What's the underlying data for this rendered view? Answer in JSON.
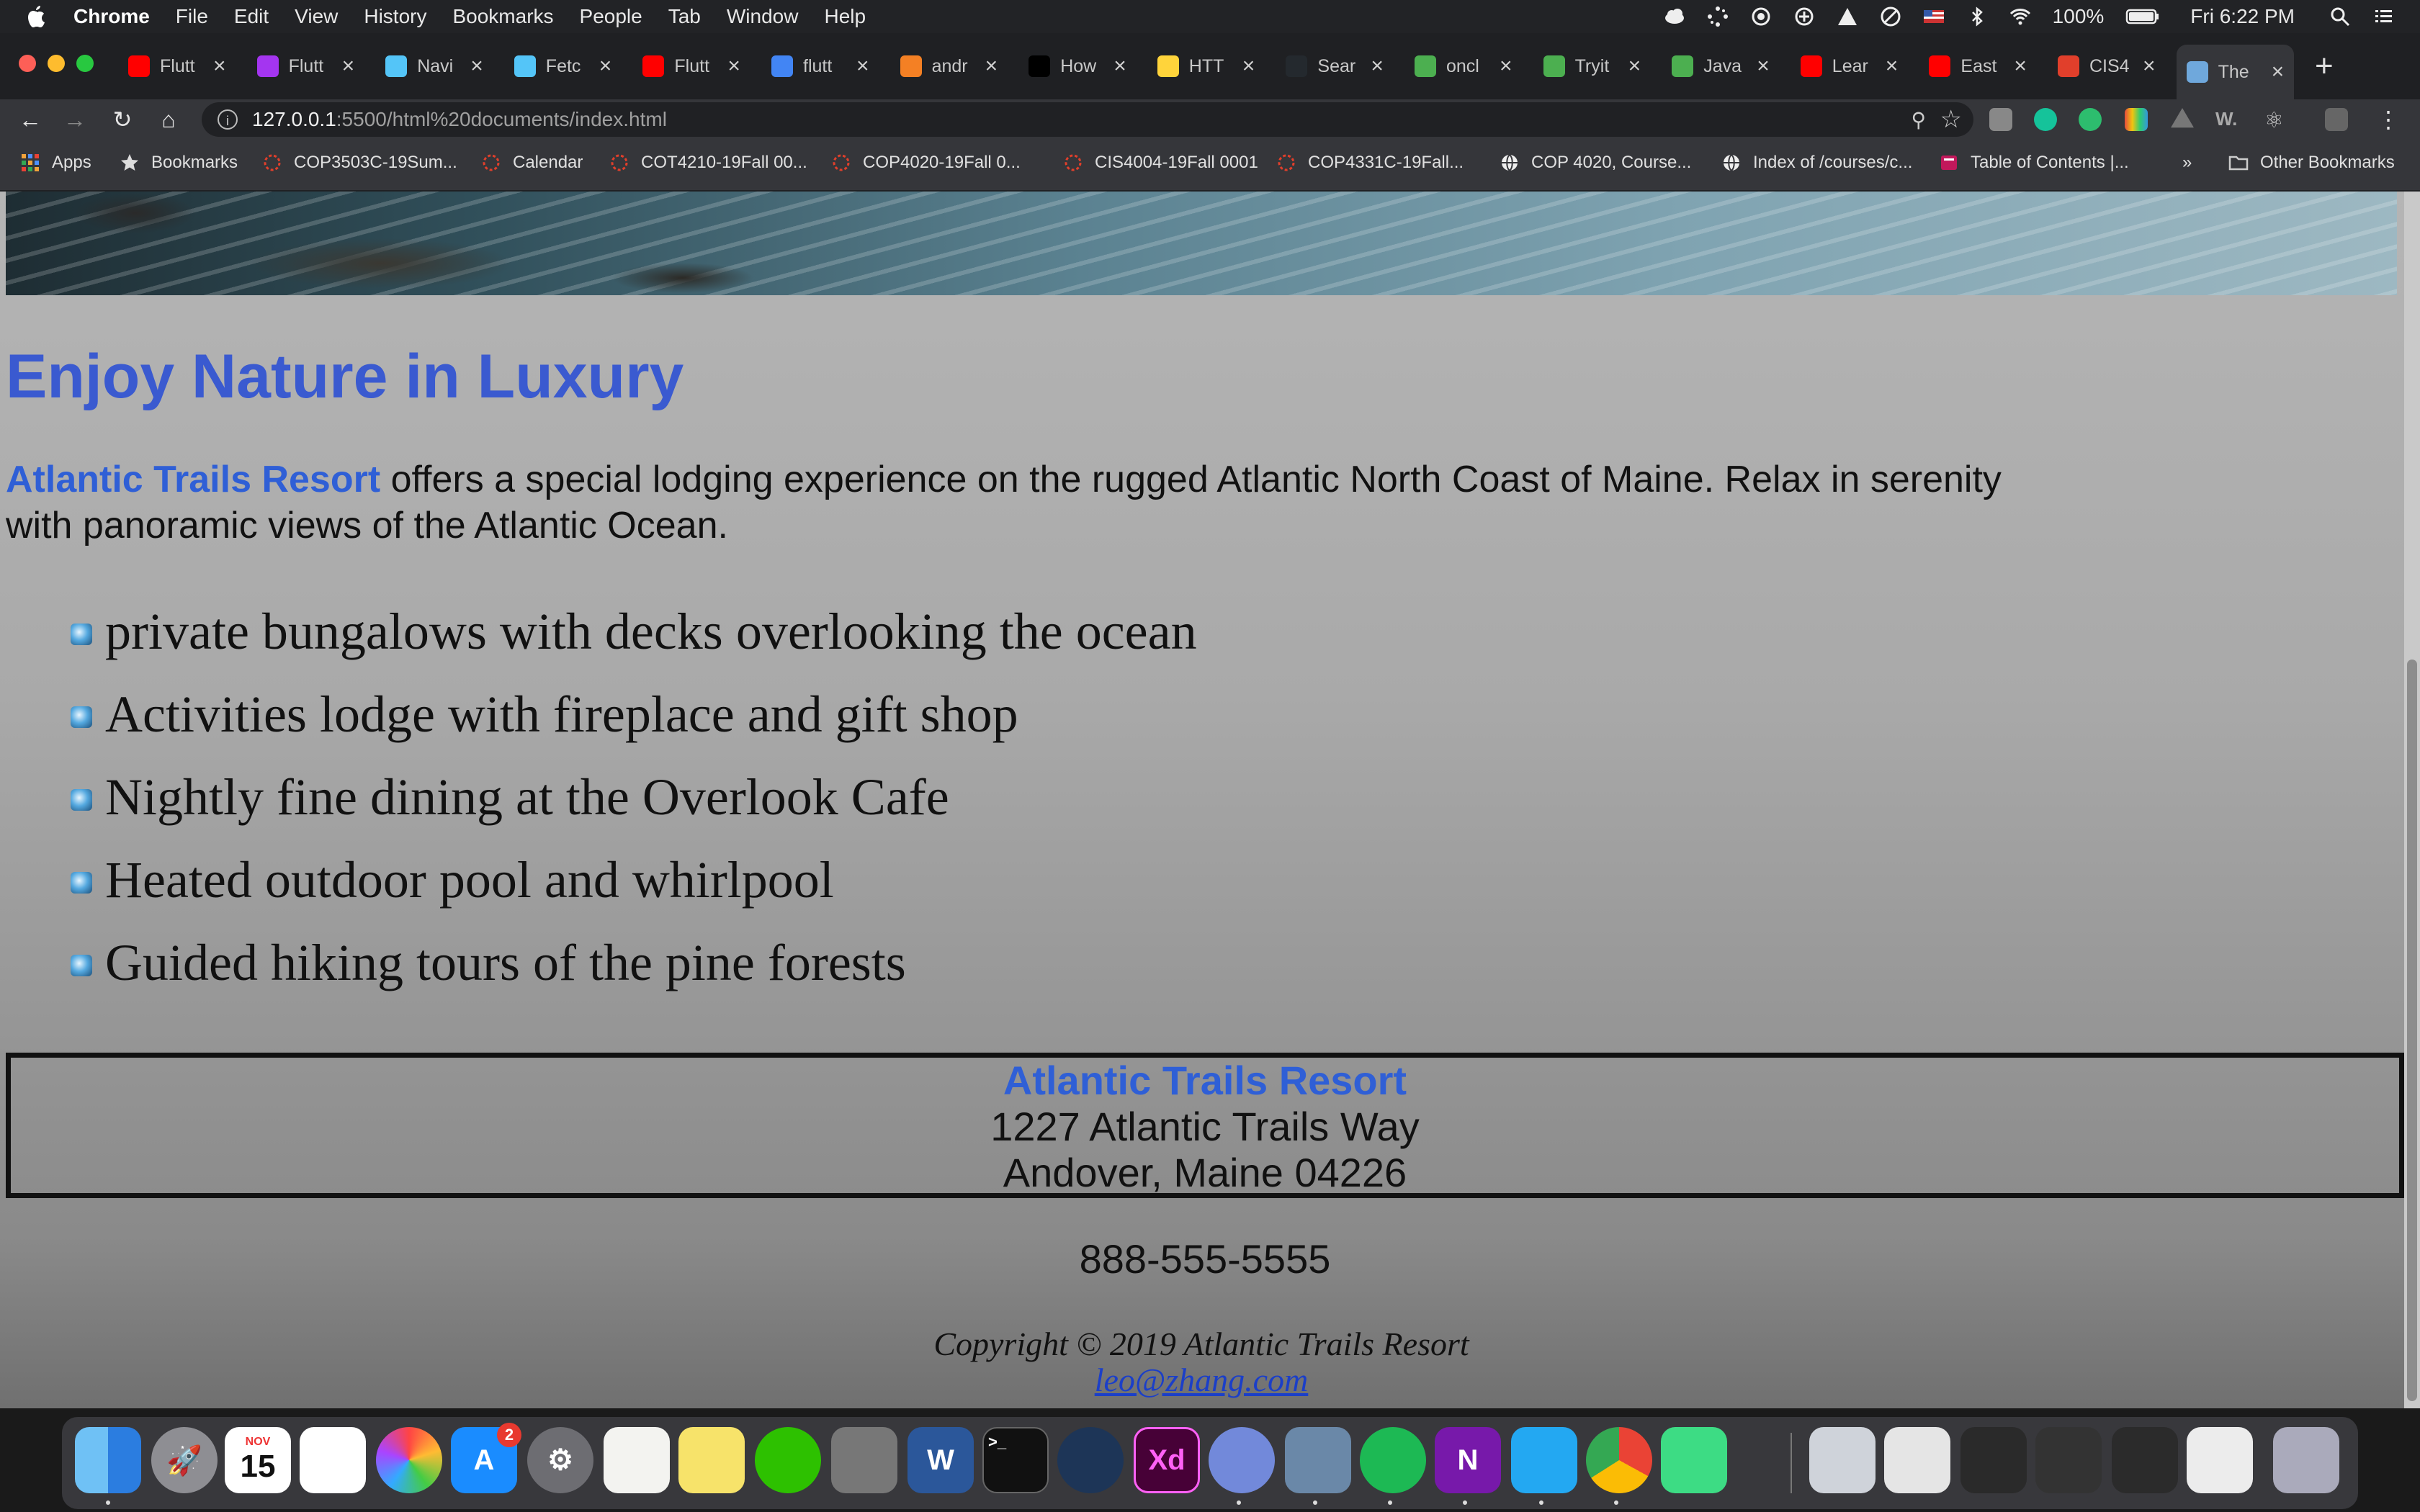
{
  "menubar": {
    "app": "Chrome",
    "items": [
      "File",
      "Edit",
      "View",
      "History",
      "Bookmarks",
      "People",
      "Tab",
      "Window",
      "Help"
    ],
    "battery": "100%",
    "clock": "Fri 6:22 PM"
  },
  "tabs": [
    {
      "title": "Flutt",
      "icon": "youtube-icon",
      "color": "#ff0000"
    },
    {
      "title": "Flutt",
      "icon": "udemy-icon",
      "color": "#a435f0"
    },
    {
      "title": "Navi",
      "icon": "flutter-icon",
      "color": "#54c5f8"
    },
    {
      "title": "Fetc",
      "icon": "flutter-icon",
      "color": "#54c5f8"
    },
    {
      "title": "Flutt",
      "icon": "youtube-icon",
      "color": "#ff0000"
    },
    {
      "title": "flutt",
      "icon": "google-icon",
      "color": "#4285f4"
    },
    {
      "title": "andr",
      "icon": "stackoverflow-icon",
      "color": "#f48024"
    },
    {
      "title": "How",
      "icon": "medium-icon",
      "color": "#000000"
    },
    {
      "title": "HTT",
      "icon": "python-icon",
      "color": "#ffd43b"
    },
    {
      "title": "Sear",
      "icon": "github-icon",
      "color": "#24292e"
    },
    {
      "title": "oncl",
      "icon": "w3schools-icon",
      "color": "#4caf50"
    },
    {
      "title": "Tryit",
      "icon": "w3schools-icon",
      "color": "#4caf50"
    },
    {
      "title": "Java",
      "icon": "w3schools-icon",
      "color": "#4caf50"
    },
    {
      "title": "Lear",
      "icon": "youtube-icon",
      "color": "#ff0000"
    },
    {
      "title": "East",
      "icon": "youtube-icon",
      "color": "#ff0000"
    },
    {
      "title": "CIS4",
      "icon": "canvas-icon",
      "color": "#e13f2b"
    },
    {
      "title": "The",
      "icon": "page-icon",
      "color": "#6fa8dc"
    }
  ],
  "address": {
    "host": "127.0.0.1",
    "path": ":5500/html%20documents/index.html"
  },
  "bookmarks": [
    {
      "label": "Apps",
      "icon": "apps-grid-icon"
    },
    {
      "label": "Bookmarks",
      "icon": "star-icon"
    },
    {
      "label": "COP3503C-19Sum...",
      "icon": "canvas-icon"
    },
    {
      "label": "Calendar",
      "icon": "canvas-icon"
    },
    {
      "label": "COT4210-19Fall 00...",
      "icon": "canvas-icon"
    },
    {
      "label": "COP4020-19Fall 0...",
      "icon": "canvas-icon"
    },
    {
      "label": "CIS4004-19Fall 0001",
      "icon": "canvas-icon"
    },
    {
      "label": "COP4331C-19Fall...",
      "icon": "canvas-icon"
    },
    {
      "label": "COP 4020, Course...",
      "icon": "globe-icon"
    },
    {
      "label": "Index of /courses/c...",
      "icon": "globe-icon"
    },
    {
      "label": "Table of Contents |...",
      "icon": "book-icon"
    }
  ],
  "bookmarks_more": "»",
  "other_bookmarks": "Other Bookmarks",
  "page": {
    "heading": "Enjoy Nature in Luxury",
    "intro_brand": "Atlantic Trails Resort",
    "intro_text": " offers a special lodging experience on the rugged Atlantic North Coast of Maine. Relax in serenity with panoramic views of the Atlantic Ocean.",
    "features": [
      "private bungalows with decks overlooking the ocean",
      "Activities lodge with fireplace and gift shop",
      "Nightly fine dining at the Overlook Cafe",
      "Heated outdoor pool and whirlpool",
      "Guided hiking tours of the pine forests"
    ],
    "contact": {
      "name": "Atlantic Trails Resort",
      "street": "1227 Atlantic Trails Way",
      "city": "Andover, Maine 04226",
      "phone": "888-555-5555"
    },
    "copyright": "Copyright © 2019 Atlantic Trails Resort",
    "email": "leo@zhang.com"
  },
  "dock": {
    "calendar_month": "NOV",
    "calendar_day": "15",
    "appstore_badge": "2",
    "xd_label": "Xd",
    "word_label": "W",
    "onenote_label": "N"
  },
  "colors": {
    "heading": "#3a5ad0",
    "brand": "#2f5fd6",
    "link": "#1b3fc8"
  }
}
